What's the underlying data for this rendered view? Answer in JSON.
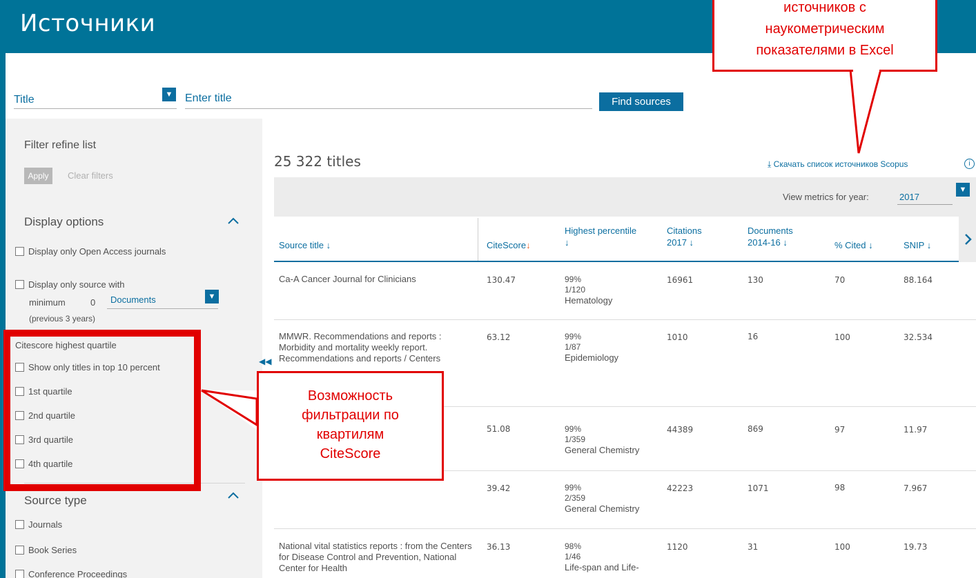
{
  "header": {
    "title": "Источники"
  },
  "search": {
    "field_label": "Title",
    "placeholder": "Enter title",
    "find_button": "Find sources"
  },
  "sidebar": {
    "filter_title": "Filter refine list",
    "apply": "Apply",
    "clear": "Clear filters",
    "display_options": {
      "heading": "Display options",
      "open_access": "Display only Open Access journals",
      "min_source": "Display only source with",
      "minimum_label": "minimum",
      "minimum_value": "0",
      "documents_option": "Documents",
      "previous_years": "(previous 3 years)"
    },
    "quartile": {
      "heading": "Citescore highest quartile",
      "items": [
        "Show only titles in top 10 percent",
        "1st quartile",
        "2nd quartile",
        "3rd quartile",
        "4th quartile"
      ]
    },
    "source_type": {
      "heading": "Source type",
      "items": [
        "Journals",
        "Book Series",
        "Conference Proceedings"
      ]
    }
  },
  "results": {
    "count": "25 322 titles",
    "download_link": "Скачать список источников Scopus",
    "metrics_label": "View metrics for year:",
    "metrics_year": "2017",
    "columns": {
      "source_title": "Source title",
      "citescore": "CiteScore",
      "highest_percentile": "Highest percentile",
      "citations": "Citations",
      "citations_year": "2017",
      "documents": "Documents",
      "documents_years": "2014-16",
      "pct_cited": "% Cited",
      "snip": "SNIP"
    },
    "rows": [
      {
        "title": "Ca-A Cancer Journal for Clinicians",
        "citescore": "130.47",
        "percentile": "99%",
        "rank": "1/120",
        "category": "Hematology",
        "citations": "16961",
        "documents": "130",
        "cited": "70",
        "snip": "88.164"
      },
      {
        "title": "MMWR. Recommendations and reports : Morbidity and mortality weekly report. Recommendations and reports / Centers",
        "citescore": "63.12",
        "percentile": "99%",
        "rank": "1/87",
        "category": "Epidemiology",
        "citations": "1010",
        "documents": "16",
        "cited": "100",
        "snip": "32.534"
      },
      {
        "title": "",
        "citescore": "51.08",
        "percentile": "99%",
        "rank": "1/359",
        "category": "General Chemistry",
        "citations": "44389",
        "documents": "869",
        "cited": "97",
        "snip": "11.97"
      },
      {
        "title": "",
        "citescore": "39.42",
        "percentile": "99%",
        "rank": "2/359",
        "category": "General Chemistry",
        "citations": "42223",
        "documents": "1071",
        "cited": "98",
        "snip": "7.967"
      },
      {
        "title": "National vital statistics reports : from the Centers for Disease Control and Prevention, National Center for Health",
        "citescore": "36.13",
        "percentile": "98%",
        "rank": "1/46",
        "category": "Life-span and Life-",
        "citations": "1120",
        "documents": "31",
        "cited": "100",
        "snip": "19.73"
      }
    ]
  },
  "annotations": {
    "top_callout": [
      "источников с",
      "наукометрическим",
      "показателями  в Excel"
    ],
    "left_callout": [
      "Возможность",
      "фильтрации  по",
      "квартилям",
      "CiteScore"
    ]
  },
  "colors": {
    "header": "#007398",
    "link": "#0b6ea0",
    "sort_active": "#e8642c",
    "annotation": "#e10000"
  }
}
